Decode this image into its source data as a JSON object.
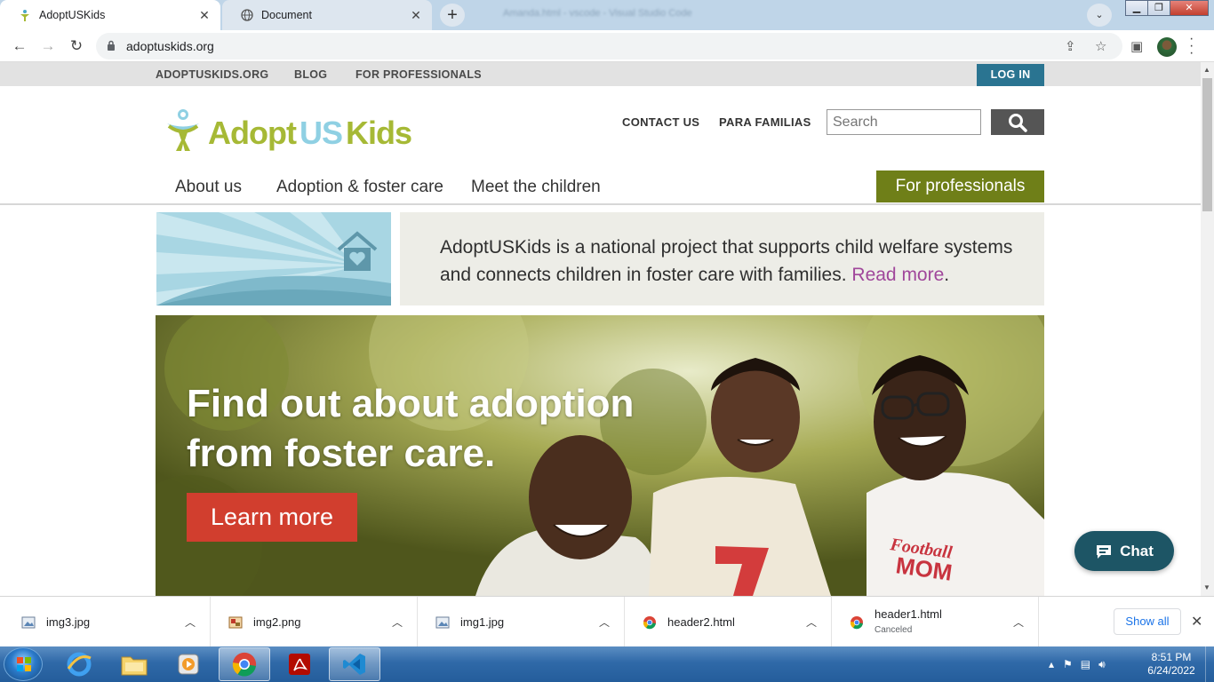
{
  "browser": {
    "tabs": [
      {
        "title": "AdoptUSKids",
        "active": true
      },
      {
        "title": "Document",
        "active": false
      }
    ],
    "new_tab_label": "+",
    "window_title_ghost": "Amanda.html - vscode - Visual Studio Code",
    "url": "adoptuskids.org"
  },
  "site": {
    "utility_nav": [
      "ADOPTUSKIDS.ORG",
      "BLOG",
      "FOR PROFESSIONALS"
    ],
    "login_label": "LOG IN",
    "logo": {
      "adopt": "Adopt",
      "us": "US",
      "kids": "Kids"
    },
    "header_links": [
      "CONTACT US",
      "PARA FAMILIAS"
    ],
    "search_placeholder": "Search",
    "main_nav": [
      "About us",
      "Adoption & foster care",
      "Meet the children"
    ],
    "for_professionals_label": "For professionals",
    "intro_text": "AdoptUSKids is a national project that supports child welfare systems and connects children in foster care with families.",
    "read_more_label": "Read more",
    "hero": {
      "headline_line1": "Find out about adoption",
      "headline_line2": "from foster care.",
      "cta_label": "Learn more",
      "shirt_text": "Football MOM"
    },
    "chat_label": "Chat"
  },
  "downloads": [
    {
      "name": "img3.jpg",
      "type": "image",
      "status": ""
    },
    {
      "name": "img2.png",
      "type": "image-png",
      "status": ""
    },
    {
      "name": "img1.jpg",
      "type": "image",
      "status": ""
    },
    {
      "name": "header2.html",
      "type": "chrome",
      "status": ""
    },
    {
      "name": "header1.html",
      "type": "chrome",
      "status": "Canceled"
    }
  ],
  "show_all_label": "Show all",
  "taskbar": {
    "apps": [
      "internet-explorer",
      "file-explorer",
      "media-player",
      "chrome",
      "acrobat",
      "vscode"
    ],
    "time": "8:51 PM",
    "date": "6/24/2022"
  },
  "colors": {
    "brand_green": "#a6b935",
    "brand_blue": "#8fd0e3",
    "login_teal": "#2a7491",
    "pros_olive": "#6f7f18",
    "cta_red": "#d13e2e",
    "read_more_purple": "#a0479b",
    "chat_teal": "#1d5565"
  }
}
